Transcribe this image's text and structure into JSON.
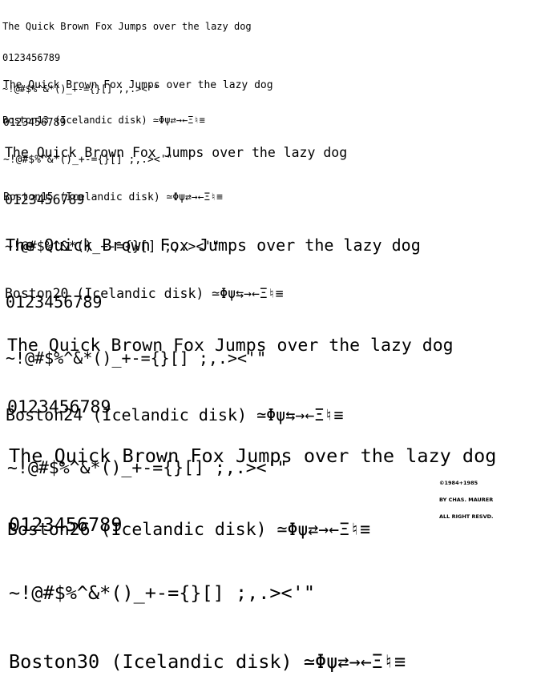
{
  "specimens": [
    {
      "pangram": "The Quick Brown Fox Jumps over the lazy dog",
      "digits": "0123456789",
      "symbols": "~!@#$%^&*()_+-={}[] ;,.><'\"",
      "name": "Boston13 (Icelandic disk) ≃Φψ⇄→←Ξ♮≡"
    },
    {
      "pangram": "The Quick Brown Fox Jumps over the lazy dog",
      "digits": "0123456789",
      "symbols": "~!@#$%^&*()_+-={}[] ;,.><'\"",
      "name": "Boston15 (Icelandic disk) ≃Φψ⇄→←Ξ♮≡"
    },
    {
      "pangram": "The Quick Brown Fox Jumps over the lazy dog",
      "digits": "0123456789",
      "symbols": "~!@#$%^&*()_+-={}[] ;,.><'\"",
      "name": "Boston20 (Icelandic disk) ≃Φψ⇆→←Ξ♮≡"
    },
    {
      "pangram": "The Quick Brown Fox Jumps over the lazy dog",
      "digits": "0123456789",
      "symbols": "~!@#$%^&*()_+-={}[] ;,.><'\"",
      "name": "Boston24 (Icelandic disk) ≃Φψ⇆→←Ξ♮≡"
    },
    {
      "pangram": "The Quick Brown Fox Jumps over the lazy dog",
      "digits": "0123456789",
      "symbols": "~!@#$%^&*()_+-={}[] ;,.><'\"",
      "name": "Boston26 (Icelandic disk) ≃Φψ⇄→←Ξ♮≡"
    },
    {
      "pangram": "The Quick Brown Fox Jumps over the lazy dog",
      "digits": "0123456789",
      "symbols": "~!@#$%^&*()_+-={}[] ;,.><'\"",
      "name": "Boston30 (Icelandic disk) ≃Φψ⇄→←Ξ♮≡"
    }
  ],
  "copyright": {
    "line1": "©1984+1985",
    "line2": "BY CHAS. MAURER",
    "line3": "ALL RIGHT RESVD."
  }
}
